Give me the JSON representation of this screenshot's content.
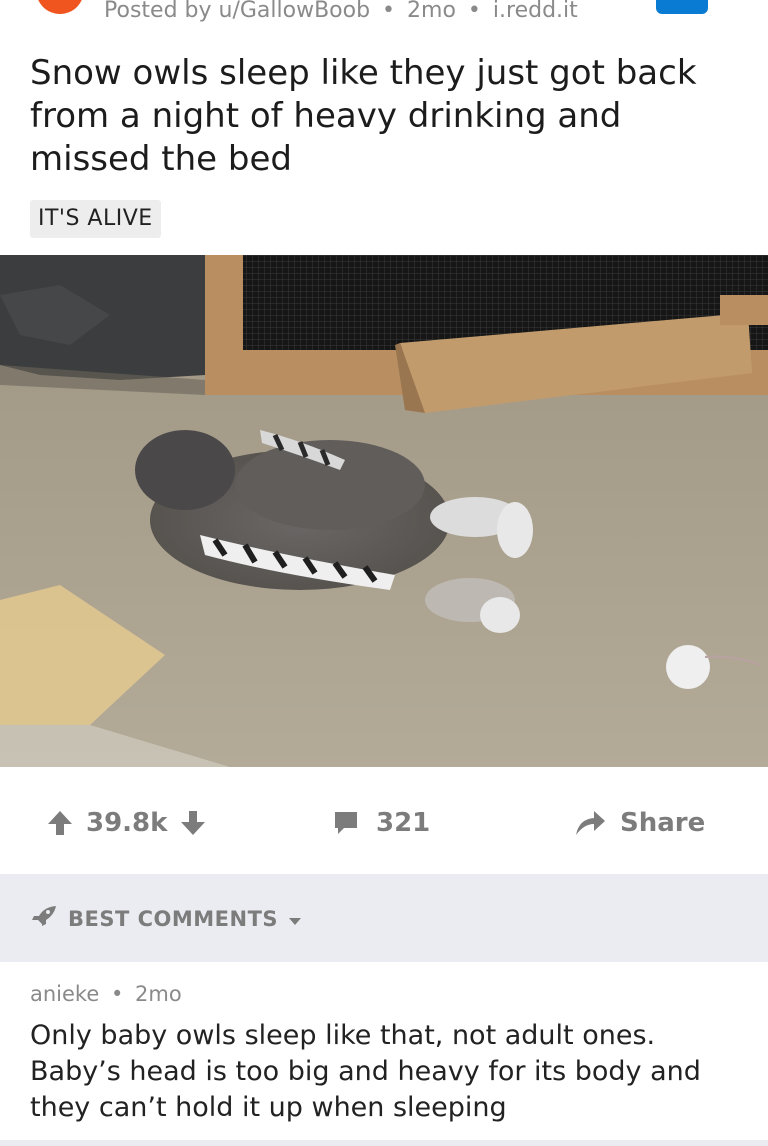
{
  "post": {
    "meta": {
      "author": "Posted by u/GallowBoob",
      "sep": "•",
      "age": "2mo",
      "domain": "i.redd.it"
    },
    "title": "Snow owls sleep like they just got back from a night of heavy drinking and missed the bed",
    "flair": "IT'S ALIVE",
    "image_icon": "owl-photo"
  },
  "actions": {
    "upvote_icon": "arrow-up-icon",
    "score": "39.8k",
    "downvote_icon": "arrow-down-icon",
    "comment_icon": "speech-bubble-icon",
    "comments": "321",
    "share_icon": "share-arrow-icon",
    "share_label": "Share"
  },
  "sort": {
    "icon": "rocket-icon",
    "label": "BEST COMMENTS"
  },
  "comments": [
    {
      "author": "anieke",
      "sep": "•",
      "age": "2mo",
      "lines": [
        "Only baby owls sleep like that, not adult ones.",
        "Baby’s head is too big and heavy for its body and",
        "they can’t hold it up when sleeping"
      ]
    }
  ],
  "colors": {
    "accent_blue": "#0a7bd3",
    "avatar_orange": "#f0541f",
    "muted_text": "#7c7c7c",
    "sort_bar_bg": "#ebecf1"
  }
}
